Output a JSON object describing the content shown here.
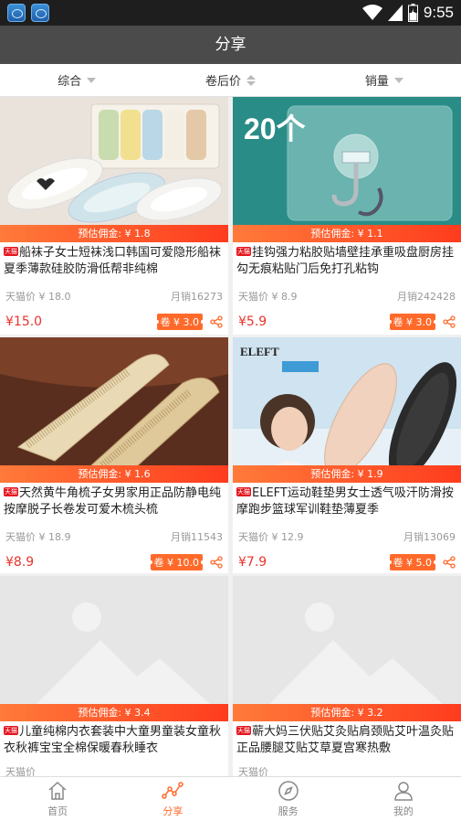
{
  "status_bar": {
    "time": "9:55",
    "battery_level": 0.5
  },
  "header": {
    "title": "分享"
  },
  "sort_bar": {
    "items": [
      {
        "label": "综合",
        "indicator": "triangle-down"
      },
      {
        "label": "卷后价",
        "indicator": "triangle-updown"
      },
      {
        "label": "销量",
        "indicator": "triangle-down"
      }
    ]
  },
  "products": [
    {
      "commission": "预估佣金: ¥ 1.8",
      "badge": "天猫",
      "title": "船袜子女士短袜浅口韩国可爱隐形船袜夏季薄款硅胶防滑低帮非纯棉",
      "tmall_label": "天猫价",
      "tmall_price": "¥ 18.0",
      "sales": "月销16273",
      "final_price": "¥15.0",
      "coupon": "卷 ¥ 3.0",
      "image": "socks"
    },
    {
      "commission": "预估佣金: ¥ 1.1",
      "badge": "天猫",
      "title": "挂钩强力粘胶贴墙壁挂承重吸盘厨房挂勾无痕粘贴门后免打孔粘钩",
      "tmall_label": "天猫价",
      "tmall_price": "¥ 8.9",
      "sales": "月销242428",
      "final_price": "¥5.9",
      "coupon": "卷 ¥ 3.0",
      "image": "hook",
      "image_text": "20个"
    },
    {
      "commission": "预估佣金: ¥ 1.6",
      "badge": "天猫",
      "title": "天然黄牛角梳子女男家用正品防静电纯按摩脱子长卷发可爱木梳头梳",
      "tmall_label": "天猫价",
      "tmall_price": "¥ 18.9",
      "sales": "月销11543",
      "final_price": "¥8.9",
      "coupon": "卷 ¥ 10.0",
      "image": "comb"
    },
    {
      "commission": "预估佣金: ¥ 1.9",
      "badge": "天猫",
      "title": "ELEFT运动鞋垫男女士透气吸汗防滑按摩跑步篮球军训鞋垫薄夏季",
      "tmall_label": "天猫价",
      "tmall_price": "¥ 12.9",
      "sales": "月销13069",
      "final_price": "¥7.9",
      "coupon": "卷 ¥ 5.0",
      "image": "insole",
      "image_text": "ELEFT"
    },
    {
      "commission": "预估佣金: ¥ 3.4",
      "badge": "天猫",
      "title": "儿童纯棉内衣套装中大童男童装女童秋衣秋裤宝宝全棉保暖春秋睡衣",
      "tmall_label": "天猫价",
      "tmall_price": "",
      "sales": "",
      "final_price": "",
      "coupon": "",
      "image": "placeholder"
    },
    {
      "commission": "预估佣金: ¥ 3.2",
      "badge": "天猫",
      "title": "蕲大妈三伏贴艾灸贴肩颈贴艾叶温灸贴正品腰腿艾贴艾草夏宫寒热敷",
      "tmall_label": "天猫价",
      "tmall_price": "",
      "sales": "",
      "final_price": "",
      "coupon": "",
      "image": "placeholder"
    }
  ],
  "tab_bar": {
    "tabs": [
      {
        "label": "首页",
        "icon": "home-icon",
        "active": false
      },
      {
        "label": "分享",
        "icon": "share-chart-icon",
        "active": true
      },
      {
        "label": "服务",
        "icon": "compass-icon",
        "active": false
      },
      {
        "label": "我的",
        "icon": "user-icon",
        "active": false
      }
    ]
  },
  "colors": {
    "accent": "#ff6a2b",
    "price": "#e8342a",
    "header": "#4b4b4b",
    "statusbar": "#1e1e1e"
  }
}
